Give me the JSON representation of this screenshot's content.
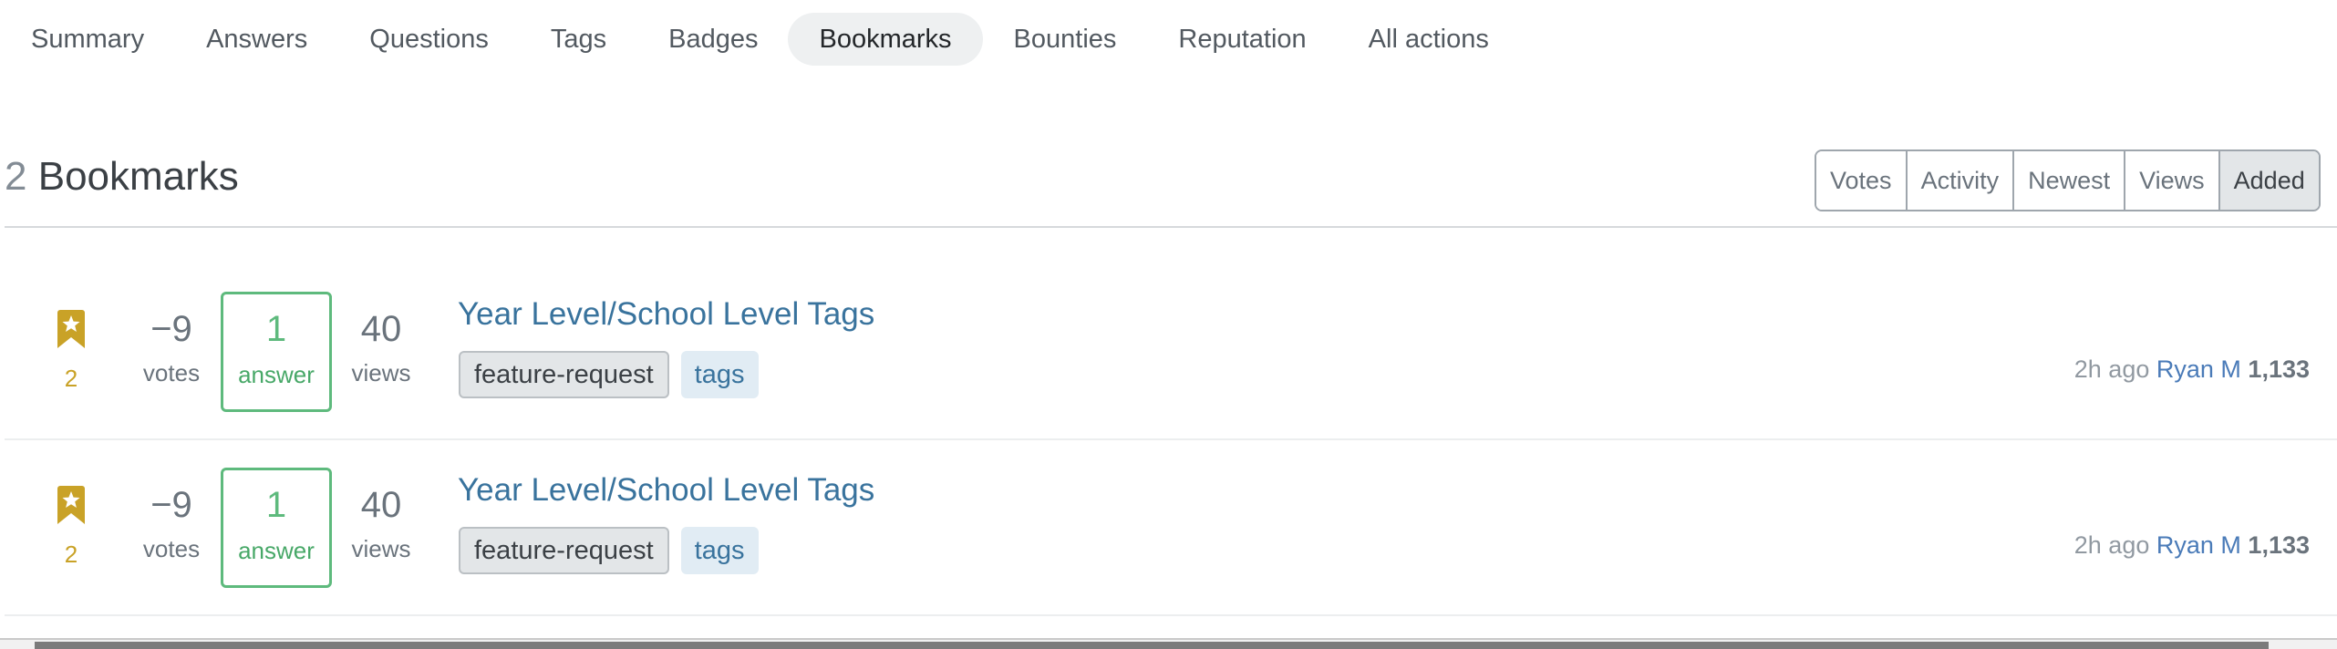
{
  "nav": {
    "tabs": [
      {
        "label": "Summary",
        "active": false
      },
      {
        "label": "Answers",
        "active": false
      },
      {
        "label": "Questions",
        "active": false
      },
      {
        "label": "Tags",
        "active": false
      },
      {
        "label": "Badges",
        "active": false
      },
      {
        "label": "Bookmarks",
        "active": true
      },
      {
        "label": "Bounties",
        "active": false
      },
      {
        "label": "Reputation",
        "active": false
      },
      {
        "label": "All actions",
        "active": false
      }
    ]
  },
  "header": {
    "count": "2",
    "title": "Bookmarks"
  },
  "sort": {
    "options": [
      "Votes",
      "Activity",
      "Newest",
      "Views",
      "Added"
    ],
    "selected": "Added"
  },
  "bookmarks": [
    {
      "bookmark_icon": "bookmark-star-icon",
      "bookmark_count": "2",
      "votes": "−9",
      "votes_label": "votes",
      "answers": "1",
      "answers_label": "answer",
      "views": "40",
      "views_label": "views",
      "title": "Year Level/School Level Tags",
      "tags": [
        {
          "name": "feature-request",
          "kind": "moderator"
        },
        {
          "name": "tags",
          "kind": "standard"
        }
      ],
      "time": "2h ago",
      "user": "Ryan M",
      "reputation": "1,133"
    },
    {
      "bookmark_icon": "bookmark-star-icon",
      "bookmark_count": "2",
      "votes": "−9",
      "votes_label": "votes",
      "answers": "1",
      "answers_label": "answer",
      "views": "40",
      "views_label": "views",
      "title": "Year Level/School Level Tags",
      "tags": [
        {
          "name": "feature-request",
          "kind": "moderator"
        },
        {
          "name": "tags",
          "kind": "standard"
        }
      ],
      "time": "2h ago",
      "user": "Ryan M",
      "reputation": "1,133"
    }
  ],
  "colors": {
    "accent_link": "#39739d",
    "answered_green": "#5eba7d",
    "bookmark_gold": "#c9a227",
    "tag_blue_bg": "#e1ecf4",
    "tag_mod_bg": "#e3e6e8"
  }
}
